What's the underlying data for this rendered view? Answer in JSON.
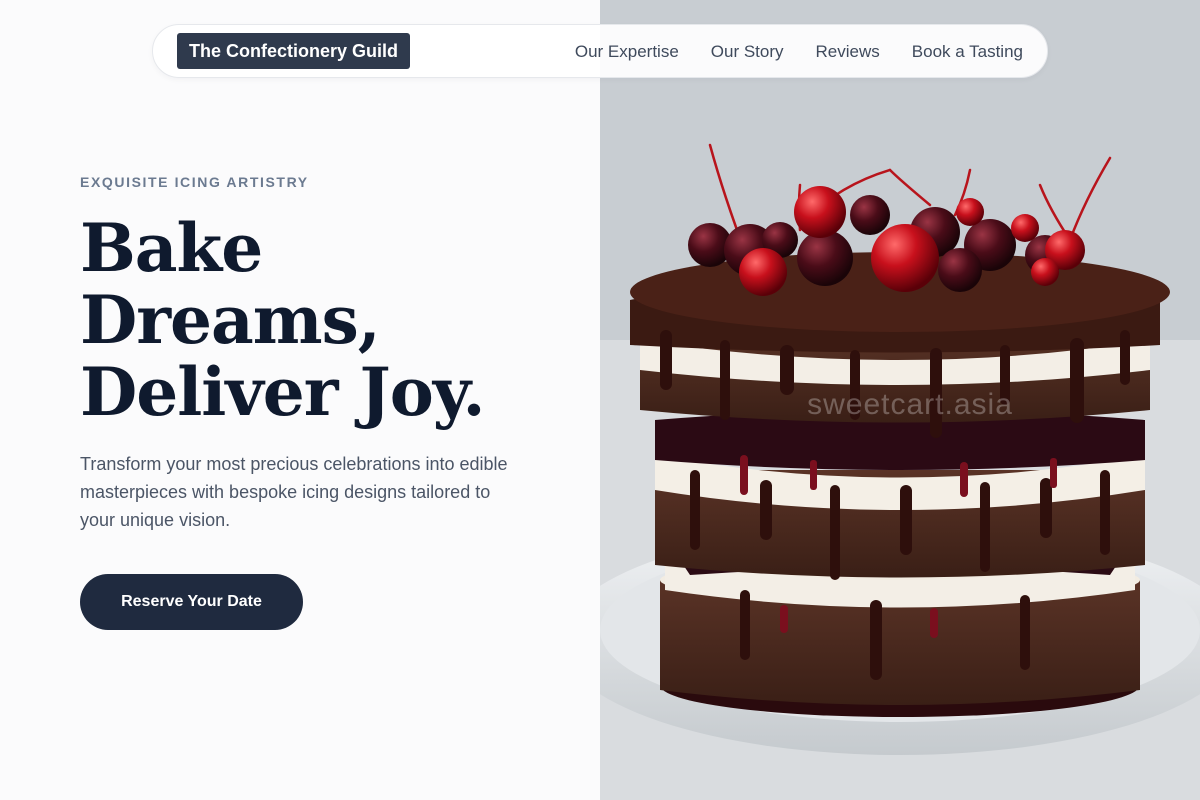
{
  "header": {
    "brand": "The Confectionery Guild",
    "nav": [
      "Our Expertise",
      "Our Story",
      "Reviews",
      "Book a Tasting"
    ]
  },
  "hero": {
    "eyebrow": "EXQUISITE ICING ARTISTRY",
    "headline": [
      "Bake",
      "Dreams,",
      "Deliver Joy."
    ],
    "subtext": "Transform your most precious celebrations into edible masterpieces with bespoke icing designs tailored to your unique vision.",
    "cta": "Reserve Your Date"
  },
  "photo": {
    "subject": "layered chocolate cherry cake",
    "watermark": "sweetcart.asia"
  },
  "colors": {
    "brand_bg": "#2f3a4d",
    "cta_bg": "#1f2a3f",
    "heading": "#0f1a2e",
    "eyebrow": "#6b7a90",
    "body_text": "#4b5566"
  }
}
